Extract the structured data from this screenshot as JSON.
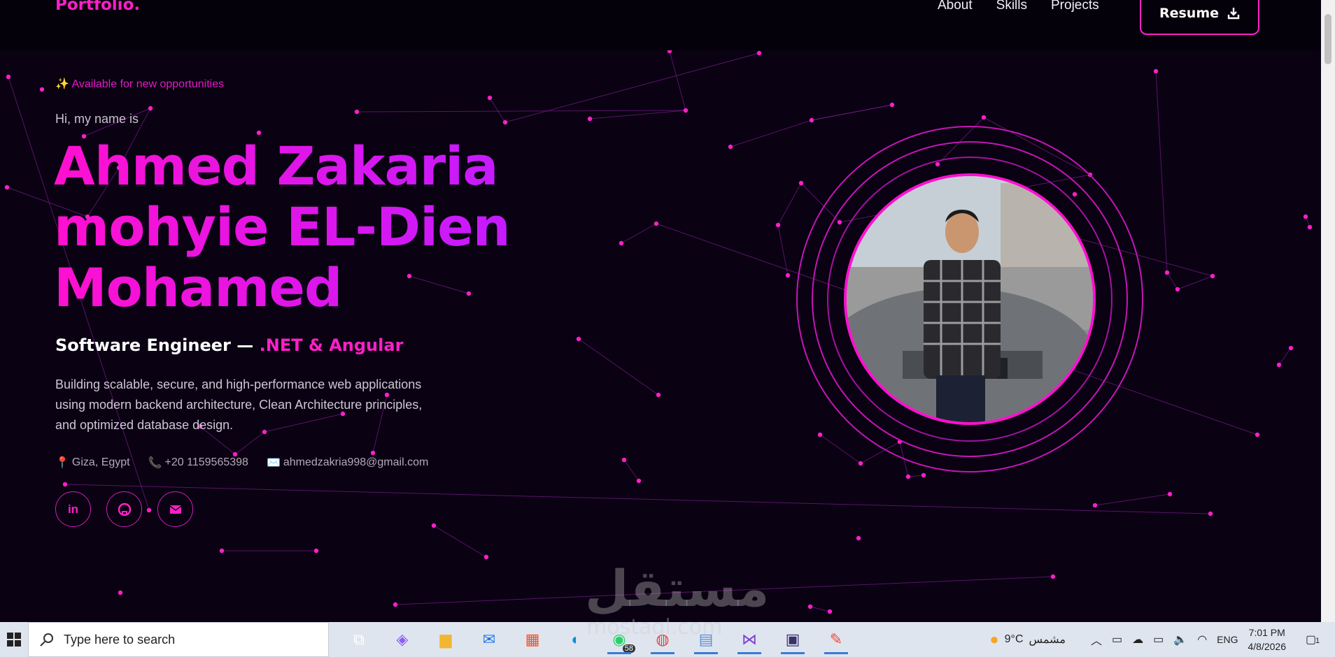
{
  "nav": {
    "logo": "Portfolio.",
    "links": [
      "About",
      "Skills",
      "Projects"
    ],
    "resume_label": "Resume"
  },
  "hero": {
    "availability": "Available for new opportunities",
    "greeting": "Hi, my name is",
    "name_lines": [
      "Ahmed Zakaria",
      "mohyie EL-Dien",
      "Mohamed"
    ],
    "role_prefix": "Software Engineer —",
    "role_accent": ".NET & Angular",
    "description": "Building scalable, secure, and high-performance web applications using modern backend architecture, Clean Architecture principles, and optimized database design.",
    "location": "Giza, Egypt",
    "phone": "+20 1159565398",
    "email": "ahmedzakria998@gmail.com",
    "socials": [
      "linkedin-icon",
      "github-icon",
      "email-icon"
    ]
  },
  "watermark": {
    "arabic": "مستقل",
    "latin": "mostaql.com"
  },
  "taskbar": {
    "search_placeholder": "Type here to search",
    "whatsapp_badge": "58",
    "weather_temp": "9°C",
    "weather_text": "مشمس",
    "language": "ENG",
    "time": "7:01 PM",
    "date": "4/8/2026",
    "notifications": "1"
  },
  "colors": {
    "accent": "#ff1fc8",
    "background": "#0a0112",
    "particles": "#ff1fc8"
  }
}
